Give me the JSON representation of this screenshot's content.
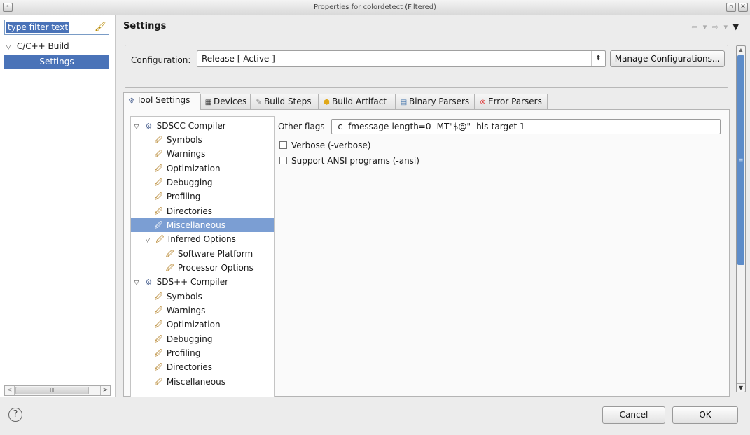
{
  "window": {
    "title": "Properties for colordetect (Filtered)"
  },
  "left_pane": {
    "filter_text": "type filter text",
    "items": [
      {
        "label": "C/C++ Build"
      },
      {
        "label": "Settings"
      }
    ]
  },
  "header": {
    "title": "Settings"
  },
  "config": {
    "label": "Configuration:",
    "value": "Release  [ Active ]",
    "manage_button": "Manage Configurations..."
  },
  "tabs": [
    {
      "label": "Tool Settings"
    },
    {
      "label": "Devices"
    },
    {
      "label": "Build Steps"
    },
    {
      "label": "Build Artifact"
    },
    {
      "label": "Binary Parsers"
    },
    {
      "label": "Error Parsers"
    }
  ],
  "tree": [
    {
      "label": "SDSCC Compiler"
    },
    {
      "label": "Symbols"
    },
    {
      "label": "Warnings"
    },
    {
      "label": "Optimization"
    },
    {
      "label": "Debugging"
    },
    {
      "label": "Profiling"
    },
    {
      "label": "Directories"
    },
    {
      "label": "Miscellaneous"
    },
    {
      "label": "Inferred Options"
    },
    {
      "label": "Software Platform"
    },
    {
      "label": "Processor Options"
    },
    {
      "label": "SDS++ Compiler"
    },
    {
      "label": "Symbols"
    },
    {
      "label": "Warnings"
    },
    {
      "label": "Optimization"
    },
    {
      "label": "Debugging"
    },
    {
      "label": "Profiling"
    },
    {
      "label": "Directories"
    },
    {
      "label": "Miscellaneous"
    }
  ],
  "settings_panel": {
    "other_flags_label": "Other flags",
    "other_flags_value": "-c -fmessage-length=0 -MT\"$@\" -hls-target 1",
    "verbose_label": "Verbose (-verbose)",
    "ansi_label": "Support ANSI programs (-ansi)"
  },
  "footer": {
    "cancel": "Cancel",
    "ok": "OK"
  },
  "colors": {
    "selection": "#4a73b8",
    "scroll_thumb": "#5d8cc9"
  }
}
